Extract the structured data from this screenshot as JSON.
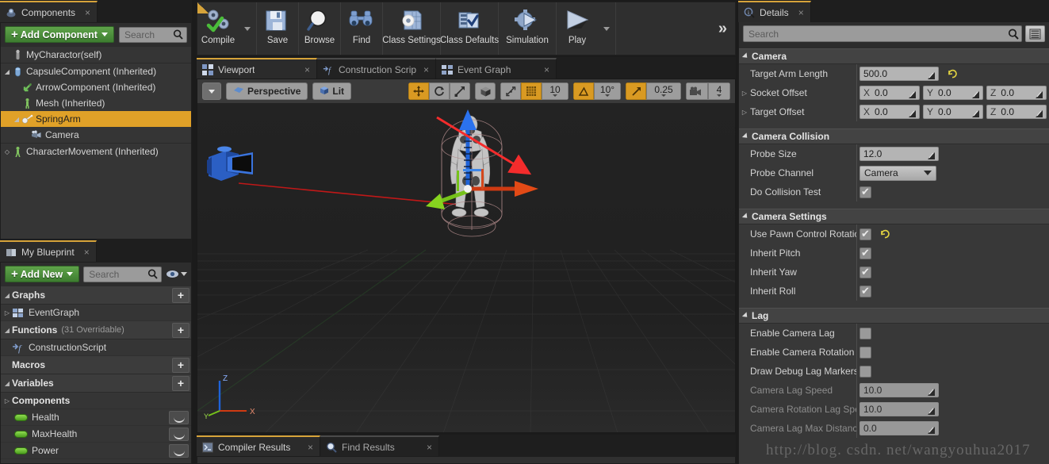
{
  "components_panel": {
    "tab_label": "Components",
    "tab_icon": "components-icon",
    "close_label": "×",
    "add_button": "Add Component",
    "search_placeholder": "Search",
    "tree": [
      {
        "label": "MyCharactor(self)",
        "icon": "pawn-icon",
        "indent": 0,
        "arrow": "",
        "selected": false
      },
      {
        "label": "CapsuleComponent (Inherited)",
        "icon": "capsule-icon",
        "indent": 0,
        "arrow": "◢",
        "selected": false
      },
      {
        "label": "ArrowComponent (Inherited)",
        "icon": "arrow-comp-icon",
        "indent": 1,
        "arrow": "",
        "selected": false
      },
      {
        "label": "Mesh (Inherited)",
        "icon": "mesh-icon",
        "indent": 1,
        "arrow": "",
        "selected": false
      },
      {
        "label": "SpringArm",
        "icon": "springarm-icon",
        "indent": 1,
        "arrow": "◢",
        "selected": true
      },
      {
        "label": "Camera",
        "icon": "camera-icon",
        "indent": 2,
        "arrow": "",
        "selected": false
      },
      {
        "label": "CharacterMovement (Inherited)",
        "icon": "charactermovement-icon",
        "indent": 0,
        "arrow": "◇",
        "selected": false
      }
    ]
  },
  "myblueprint_panel": {
    "tab_label": "My Blueprint",
    "tab_icon": "book-icon",
    "close_label": "×",
    "add_button": "Add New",
    "search_placeholder": "Search",
    "eye_icon": "eye-icon",
    "sections": [
      {
        "type": "category",
        "label": "Graphs",
        "sub": "",
        "expanded": true,
        "plus": "+"
      },
      {
        "type": "item",
        "label": "EventGraph",
        "icon": "eventgraph-icon",
        "tri": "▷"
      },
      {
        "type": "category",
        "label": "Functions",
        "sub": "(31 Overridable)",
        "expanded": true,
        "plus": "+"
      },
      {
        "type": "item",
        "label": "ConstructionScript",
        "icon": "function-icon",
        "tri": ""
      },
      {
        "type": "category",
        "label": "Macros",
        "sub": "",
        "expanded": false,
        "plus": "+"
      },
      {
        "type": "category",
        "label": "Variables",
        "sub": "",
        "expanded": true,
        "plus": "+"
      },
      {
        "type": "subcat",
        "label": "Components",
        "tri": "▷"
      },
      {
        "type": "var",
        "label": "Health"
      },
      {
        "type": "var",
        "label": "MaxHealth"
      },
      {
        "type": "var",
        "label": "Power"
      }
    ]
  },
  "toolbar": {
    "buttons": [
      {
        "label": "Compile",
        "icon": "compile-icon",
        "dropdown": true
      },
      {
        "label": "Save",
        "icon": "save-icon",
        "dropdown": false
      },
      {
        "label": "Browse",
        "icon": "browse-icon",
        "dropdown": false
      },
      {
        "label": "Find",
        "icon": "find-icon",
        "dropdown": false
      },
      {
        "label": "Class Settings",
        "icon": "class-settings-icon",
        "dropdown": false
      },
      {
        "label": "Class Defaults",
        "icon": "class-defaults-icon",
        "dropdown": false
      },
      {
        "label": "Simulation",
        "icon": "simulation-icon",
        "dropdown": false
      },
      {
        "label": "Play",
        "icon": "play-icon",
        "dropdown": true
      }
    ],
    "overflow_label": "»"
  },
  "viewport_tabs": [
    {
      "label": "Viewport",
      "icon": "grid4-icon",
      "active": true,
      "close": "×"
    },
    {
      "label": "Construction Scrip",
      "icon": "function-icon",
      "active": false,
      "close": "×"
    },
    {
      "label": "Event Graph",
      "icon": "dots4-icon",
      "active": false,
      "close": "×"
    }
  ],
  "viewport_toolbar": {
    "menu_icon": "chevron-down-icon",
    "view_mode": "Perspective",
    "view_mode_icon": "perspective-icon",
    "lighting_mode": "Lit",
    "lighting_icon": "cube-icon",
    "transform_tools": [
      {
        "name": "translate-tool",
        "active": true
      },
      {
        "name": "rotate-tool",
        "active": false
      },
      {
        "name": "scale-tool",
        "active": false
      }
    ],
    "coord_space_icon": "world-space-icon",
    "snap_surface_icon": "surface-snap-icon",
    "grid_snap_active": true,
    "grid_snap_value": "10",
    "angle_snap_active": true,
    "angle_snap_value": "10°",
    "scale_snap_active": true,
    "scale_snap_value": "0.25",
    "camera_speed_icon": "camera-speed-icon",
    "camera_speed_value": "4"
  },
  "viewport_scene": {
    "axis_labels": {
      "z": "Z",
      "x": "X",
      "y": "Y"
    },
    "annotation_arrow": "red-callout-arrow"
  },
  "bottom_tabs": [
    {
      "label": "Compiler Results",
      "icon": "compiler-icon",
      "active": true,
      "close": "×"
    },
    {
      "label": "Find Results",
      "icon": "find-results-icon",
      "active": false,
      "close": "×"
    }
  ],
  "details_panel": {
    "tab_label": "Details",
    "tab_icon": "details-icon",
    "close_label": "×",
    "search_placeholder": "Search",
    "grid_view_icon": "grid-view-icon",
    "categories": [
      {
        "name": "Camera",
        "rows": [
          {
            "label": "Target Arm Length",
            "kind": "number",
            "values": [
              "500.0"
            ],
            "reverted": true,
            "expandable": false
          },
          {
            "label": "Socket Offset",
            "kind": "vector",
            "values": [
              "0.0",
              "0.0",
              "0.0"
            ],
            "axes": [
              "X",
              "Y",
              "Z"
            ],
            "expandable": true
          },
          {
            "label": "Target Offset",
            "kind": "vector",
            "values": [
              "0.0",
              "0.0",
              "0.0"
            ],
            "axes": [
              "X",
              "Y",
              "Z"
            ],
            "expandable": true
          }
        ]
      },
      {
        "name": "Camera Collision",
        "rows": [
          {
            "label": "Probe Size",
            "kind": "number",
            "values": [
              "12.0"
            ],
            "expandable": false
          },
          {
            "label": "Probe Channel",
            "kind": "combo",
            "values": [
              "Camera"
            ],
            "expandable": false
          },
          {
            "label": "Do Collision Test",
            "kind": "checkbox",
            "checked": true,
            "expandable": false
          }
        ]
      },
      {
        "name": "Camera Settings",
        "rows": [
          {
            "label": "Use Pawn Control Rotatio",
            "kind": "checkbox",
            "checked": true,
            "reverted": true,
            "expandable": false
          },
          {
            "label": "Inherit Pitch",
            "kind": "checkbox",
            "checked": true,
            "expandable": false
          },
          {
            "label": "Inherit Yaw",
            "kind": "checkbox",
            "checked": true,
            "expandable": false
          },
          {
            "label": "Inherit Roll",
            "kind": "checkbox",
            "checked": true,
            "expandable": false
          }
        ]
      },
      {
        "name": "Lag",
        "rows": [
          {
            "label": "Enable Camera Lag",
            "kind": "checkbox",
            "checked": false,
            "expandable": false
          },
          {
            "label": "Enable Camera Rotation L",
            "kind": "checkbox",
            "checked": false,
            "expandable": false
          },
          {
            "label": "Draw Debug Lag Markers",
            "kind": "checkbox",
            "checked": false,
            "expandable": false
          },
          {
            "label": "Camera Lag Speed",
            "kind": "number",
            "values": [
              "10.0"
            ],
            "disabled": true,
            "expandable": false
          },
          {
            "label": "Camera Rotation Lag Spe",
            "kind": "number",
            "values": [
              "10.0"
            ],
            "disabled": true,
            "expandable": false
          },
          {
            "label": "Camera Lag Max Distanc",
            "kind": "number",
            "values": [
              "0.0"
            ],
            "disabled": true,
            "expandable": false
          }
        ]
      }
    ]
  },
  "watermark": "http://blog. csdn. net/wangyouhua2017",
  "colors": {
    "accent_orange": "#e0a128",
    "green_button": "#4d9238",
    "panel_bg": "#2d2d2d",
    "row_bg": "#383838",
    "annotation_red": "#f42c2c"
  }
}
